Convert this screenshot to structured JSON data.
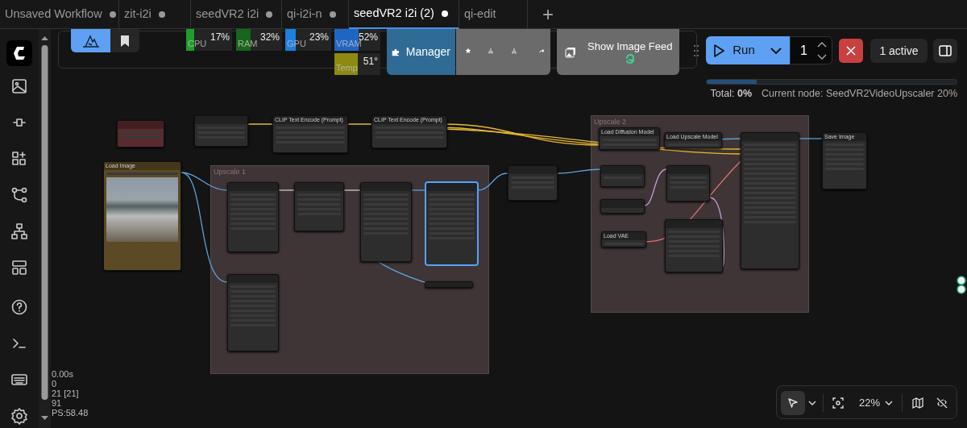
{
  "tabs": [
    {
      "label": "Unsaved Workflow",
      "selected": false,
      "modified": true
    },
    {
      "label": "zit-i2i",
      "selected": false,
      "modified": true
    },
    {
      "label": "seedVR2 i2i",
      "selected": false,
      "modified": true
    },
    {
      "label": "qi-i2i-n",
      "selected": false,
      "modified": true
    },
    {
      "label": "seedVR2 i2i (2)",
      "selected": true,
      "modified": true
    },
    {
      "label": "qi-edit",
      "selected": false,
      "modified": false
    }
  ],
  "new_tab": "+",
  "toolbar": {
    "monitors": [
      {
        "label": "CPU",
        "reading": "17%",
        "level": 0.17,
        "color": "#1e9e2a"
      },
      {
        "label": "RAM",
        "reading": "32%",
        "level": 0.32,
        "color": "#17661c"
      },
      {
        "label": "GPU",
        "reading": "23%",
        "level": 0.23,
        "color": "#1d7fe0"
      },
      {
        "label": "VRAM",
        "reading": "52%",
        "level": 0.52,
        "color": "#1f66c4"
      },
      {
        "label": "Temp",
        "reading": "51°",
        "level": 0.51,
        "color": "#8e8a0f"
      }
    ],
    "manager": "Manager",
    "image_feed": "Show Image Feed",
    "run": "Run",
    "batch_count": "1",
    "queue": "1 active"
  },
  "progress": {
    "level": 0.2,
    "total": "Total: **0%**",
    "current_node": "Current node: SeedVR2VideoUpscaler 20%"
  },
  "stats": [
    "0.00s",
    "0",
    "21 [21]",
    "91",
    "PS:58.48"
  ],
  "canvas": {
    "groups": [
      {
        "title": "Upscale 1"
      },
      {
        "title": "Upscale 2"
      }
    ],
    "nodes": [
      {
        "kind": "plain",
        "color": "#5a2a2e",
        "selected": false
      },
      {
        "kind": "plain",
        "color": "#2d2d2d",
        "selected": false
      },
      {
        "title": "CLIP Text Encode (Prompt)",
        "kind": "plain",
        "color": "#2d2d2d",
        "selected": false
      },
      {
        "title": "CLIP Text Encode (Prompt)",
        "kind": "plain",
        "color": "#2d2d2d",
        "selected": false
      },
      {
        "title": "Load Image",
        "kind": "image",
        "color": "#5c4a24",
        "selected": false
      },
      {
        "kind": "plain",
        "color": "#2d2d2d",
        "selected": false
      },
      {
        "kind": "plain",
        "color": "#2d2d2d",
        "selected": false
      },
      {
        "kind": "plain",
        "color": "#2d2d2d",
        "selected": false
      },
      {
        "kind": "plain",
        "color": "#2d2d2d",
        "selected": true
      },
      {
        "kind": "plain",
        "color": "#2d2d2d",
        "selected": false
      },
      {
        "kind": "plain",
        "color": "#2d2d2d",
        "selected": false
      },
      {
        "kind": "plain",
        "color": "#2d2d2d",
        "selected": false
      },
      {
        "title": "Load Diffusion Model",
        "kind": "plain",
        "color": "#2d2d2d",
        "selected": false
      },
      {
        "title": "Load Upscale Model",
        "kind": "plain",
        "color": "#2d2d2d",
        "selected": false
      },
      {
        "kind": "plain",
        "color": "#2d2d2d",
        "selected": false
      },
      {
        "title": "Save Image",
        "kind": "plain",
        "color": "#2d2d2d",
        "selected": false
      },
      {
        "kind": "plain",
        "color": "#2d2d2d",
        "selected": false
      },
      {
        "kind": "plain",
        "color": "#2d2d2d",
        "selected": false
      },
      {
        "kind": "plain",
        "color": "#2d2d2d",
        "selected": false
      },
      {
        "kind": "plain",
        "color": "#2d2d2d",
        "selected": false
      },
      {
        "title": "Load VAE",
        "kind": "plain",
        "color": "#2d2d2d",
        "selected": false
      }
    ]
  },
  "canvas_toolbar": {
    "pointer_selected": true,
    "zoom": "22%"
  }
}
